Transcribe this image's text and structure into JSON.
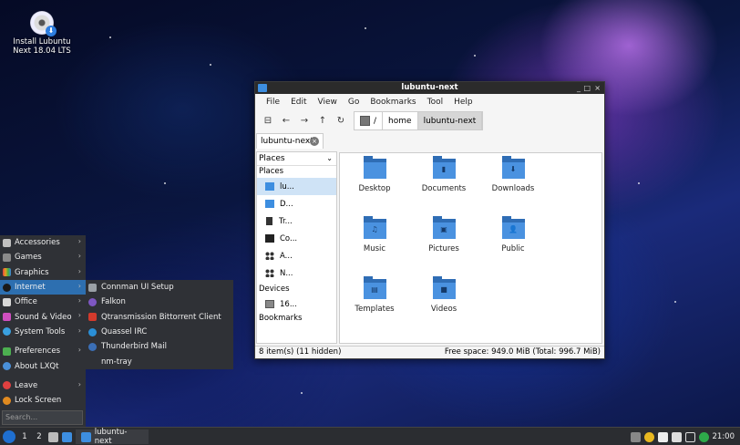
{
  "desktop": {
    "icon_label": "Install Lubuntu\nNext 18.04 LTS"
  },
  "window": {
    "title": "lubuntu-next",
    "controls": [
      "_",
      "□",
      "×"
    ],
    "menu": [
      "File",
      "Edit",
      "View",
      "Go",
      "Bookmarks",
      "Tool",
      "Help"
    ],
    "breadcrumbs": [
      "/",
      "home",
      "lubuntu-next"
    ],
    "tab_label": "lubuntu-next",
    "sidebar": {
      "header": "Places",
      "places_section": "Places",
      "places": [
        {
          "label": "lu...",
          "icon": "home-folder-icon",
          "color": "#3d8ee0"
        },
        {
          "label": "D...",
          "icon": "desktop-icon",
          "color": "#3d8ee0"
        },
        {
          "label": "Tr...",
          "icon": "trash-icon",
          "color": "#333333"
        },
        {
          "label": "Co...",
          "icon": "computer-icon",
          "color": "#222222"
        },
        {
          "label": "A...",
          "icon": "applications-icon",
          "color": "#333333"
        },
        {
          "label": "N...",
          "icon": "network-icon",
          "color": "#333333"
        }
      ],
      "devices_section": "Devices",
      "devices": [
        {
          "label": "16...",
          "icon": "drive-icon"
        }
      ],
      "bookmarks_section": "Bookmarks"
    },
    "files": [
      {
        "name": "Desktop",
        "emblem": ""
      },
      {
        "name": "Documents",
        "emblem": "▮"
      },
      {
        "name": "Downloads",
        "emblem": "⬇"
      },
      {
        "name": "Music",
        "emblem": "♫"
      },
      {
        "name": "Pictures",
        "emblem": "▣"
      },
      {
        "name": "Public",
        "emblem": "👤"
      },
      {
        "name": "Templates",
        "emblem": "▤"
      },
      {
        "name": "Videos",
        "emblem": "■"
      }
    ],
    "status_left": "8 item(s) (11 hidden)",
    "status_right": "Free space: 949.0 MiB (Total: 996.7 MiB)"
  },
  "start_menu": {
    "categories": [
      {
        "label": "Accessories",
        "icon_color": "#c0c0c0"
      },
      {
        "label": "Games",
        "icon_color": "#8a8a8a"
      },
      {
        "label": "Graphics",
        "icon_color": "#e87a2a"
      },
      {
        "label": "Internet",
        "icon_color": "#1a1a1a"
      },
      {
        "label": "Office",
        "icon_color": "#d8d8d8"
      },
      {
        "label": "Sound & Video",
        "icon_color": "#d04fc0"
      },
      {
        "label": "System Tools",
        "icon_color": "#3aa0e0"
      }
    ],
    "extras": [
      {
        "label": "Preferences",
        "icon_color": "#4caf50"
      },
      {
        "label": "About LXQt",
        "icon_color": "#4a90d9"
      }
    ],
    "session": [
      {
        "label": "Leave",
        "icon_color": "#e04040"
      },
      {
        "label": "Lock Screen",
        "icon_color": "#e08a20"
      }
    ],
    "search_placeholder": "Search...",
    "submenu": [
      {
        "label": "Connman UI Setup",
        "icon_color": "#9aa0a6"
      },
      {
        "label": "Falkon",
        "icon_color": "#7e57c2"
      },
      {
        "label": "Qtransmission Bittorrent Client",
        "icon_color": "#d33a2c"
      },
      {
        "label": "Quassel IRC",
        "icon_color": "#2a8fd6"
      },
      {
        "label": "Thunderbird Mail",
        "icon_color": "#3b6fb6"
      },
      {
        "label": "nm-tray",
        "icon_color": "#2f3136"
      }
    ]
  },
  "taskbar": {
    "workspaces": [
      "1",
      "2"
    ],
    "task_label": "lubuntu-next",
    "clock": "21:00"
  }
}
